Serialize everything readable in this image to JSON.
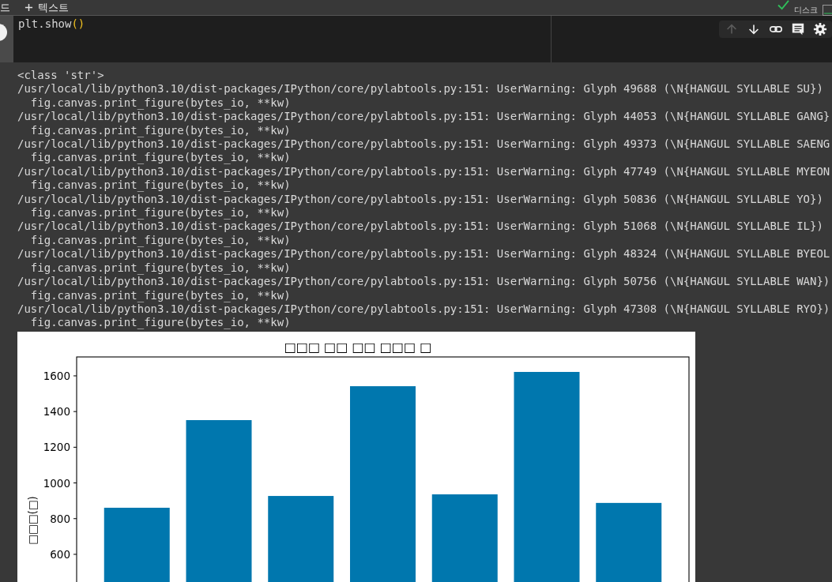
{
  "top_bar": {
    "buttons": [
      {
        "label": "드",
        "kind": "plain"
      },
      {
        "label": "텍스트",
        "kind": "add"
      }
    ],
    "status_label": "디스크"
  },
  "cell": {
    "code_tokens": [
      {
        "text": "plt.show",
        "kind": "name"
      },
      {
        "text": "()",
        "kind": "bracket"
      }
    ],
    "toolbar": [
      {
        "kind": "up",
        "disabled": true
      },
      {
        "kind": "down",
        "disabled": false
      },
      {
        "kind": "link",
        "disabled": false
      },
      {
        "kind": "comment",
        "disabled": false
      },
      {
        "kind": "settings",
        "disabled": false
      }
    ]
  },
  "output": {
    "lines": [
      "<class 'str'>",
      "/usr/local/lib/python3.10/dist-packages/IPython/core/pylabtools.py:151: UserWarning: Glyph 49688 (\\N{HANGUL SYLLABLE SU})",
      "  fig.canvas.print_figure(bytes_io, **kw)",
      "/usr/local/lib/python3.10/dist-packages/IPython/core/pylabtools.py:151: UserWarning: Glyph 44053 (\\N{HANGUL SYLLABLE GANG}",
      "  fig.canvas.print_figure(bytes_io, **kw)",
      "/usr/local/lib/python3.10/dist-packages/IPython/core/pylabtools.py:151: UserWarning: Glyph 49373 (\\N{HANGUL SYLLABLE SAENG",
      "  fig.canvas.print_figure(bytes_io, **kw)",
      "/usr/local/lib/python3.10/dist-packages/IPython/core/pylabtools.py:151: UserWarning: Glyph 47749 (\\N{HANGUL SYLLABLE MYEON",
      "  fig.canvas.print_figure(bytes_io, **kw)",
      "/usr/local/lib/python3.10/dist-packages/IPython/core/pylabtools.py:151: UserWarning: Glyph 50836 (\\N{HANGUL SYLLABLE YO})",
      "  fig.canvas.print_figure(bytes_io, **kw)",
      "/usr/local/lib/python3.10/dist-packages/IPython/core/pylabtools.py:151: UserWarning: Glyph 51068 (\\N{HANGUL SYLLABLE IL})",
      "  fig.canvas.print_figure(bytes_io, **kw)",
      "/usr/local/lib/python3.10/dist-packages/IPython/core/pylabtools.py:151: UserWarning: Glyph 48324 (\\N{HANGUL SYLLABLE BYEOL",
      "  fig.canvas.print_figure(bytes_io, **kw)",
      "/usr/local/lib/python3.10/dist-packages/IPython/core/pylabtools.py:151: UserWarning: Glyph 50756 (\\N{HANGUL SYLLABLE WAN})",
      "  fig.canvas.print_figure(bytes_io, **kw)",
      "/usr/local/lib/python3.10/dist-packages/IPython/core/pylabtools.py:151: UserWarning: Glyph 47308 (\\N{HANGUL SYLLABLE RYO})",
      "  fig.canvas.print_figure(bytes_io, **kw)"
    ],
    "chart_data": {
      "type": "bar",
      "title": "□□□ □□ □□ □□□ □",
      "ylabel": "□□□(□)",
      "series": [
        {
          "color": "#0077ae",
          "values": [
            861,
            1352,
            927,
            1542,
            936,
            1622,
            888
          ]
        }
      ],
      "ylim": [
        0,
        1706
      ],
      "yticks": [
        600,
        800,
        1000,
        1200,
        1400,
        1600
      ]
    }
  }
}
